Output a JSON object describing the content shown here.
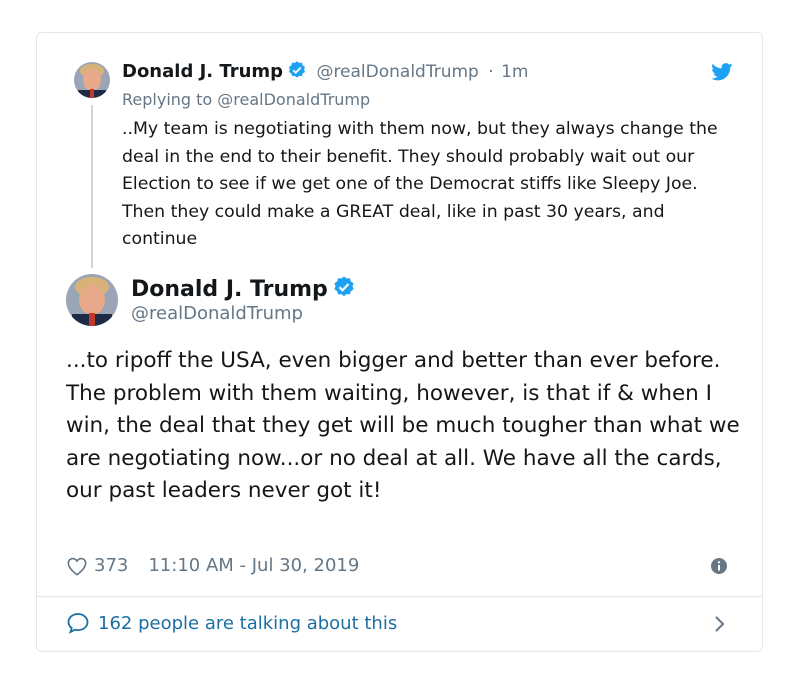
{
  "parent_tweet": {
    "name": "Donald J. Trump",
    "handle": "@realDonaldTrump",
    "separator": "·",
    "time": "1m",
    "replying_to": "Replying to @realDonaldTrump",
    "text": "..My team is negotiating with them now, but they always change the deal in the end to their benefit. They should probably wait out our Election to see if we get one of the Democrat stiffs like Sleepy Joe. Then they could make a GREAT deal, like in past 30 years, and continue"
  },
  "main_tweet": {
    "name": "Donald J. Trump",
    "handle": "@realDonaldTrump",
    "text": "...to ripoff the USA, even bigger and better than ever before. The problem with them waiting, however, is that if & when I win, the deal that they get will be much tougher than what we are negotiating now...or no deal at all. We have all the cards, our past leaders never got it!",
    "likes": "373",
    "timestamp": "11:10 AM - Jul 30, 2019"
  },
  "footer": {
    "talking_label": "162 people are talking about this"
  },
  "icons": {
    "verified": "verified-badge-icon",
    "twitter": "twitter-bird-icon",
    "like": "heart-icon",
    "info": "info-icon",
    "reply": "speech-bubble-icon",
    "chevron": "chevron-right-icon"
  },
  "colors": {
    "verified": "#1da1f2",
    "link": "#1b6fa3",
    "muted": "#657786",
    "border": "#e1e8ed"
  }
}
